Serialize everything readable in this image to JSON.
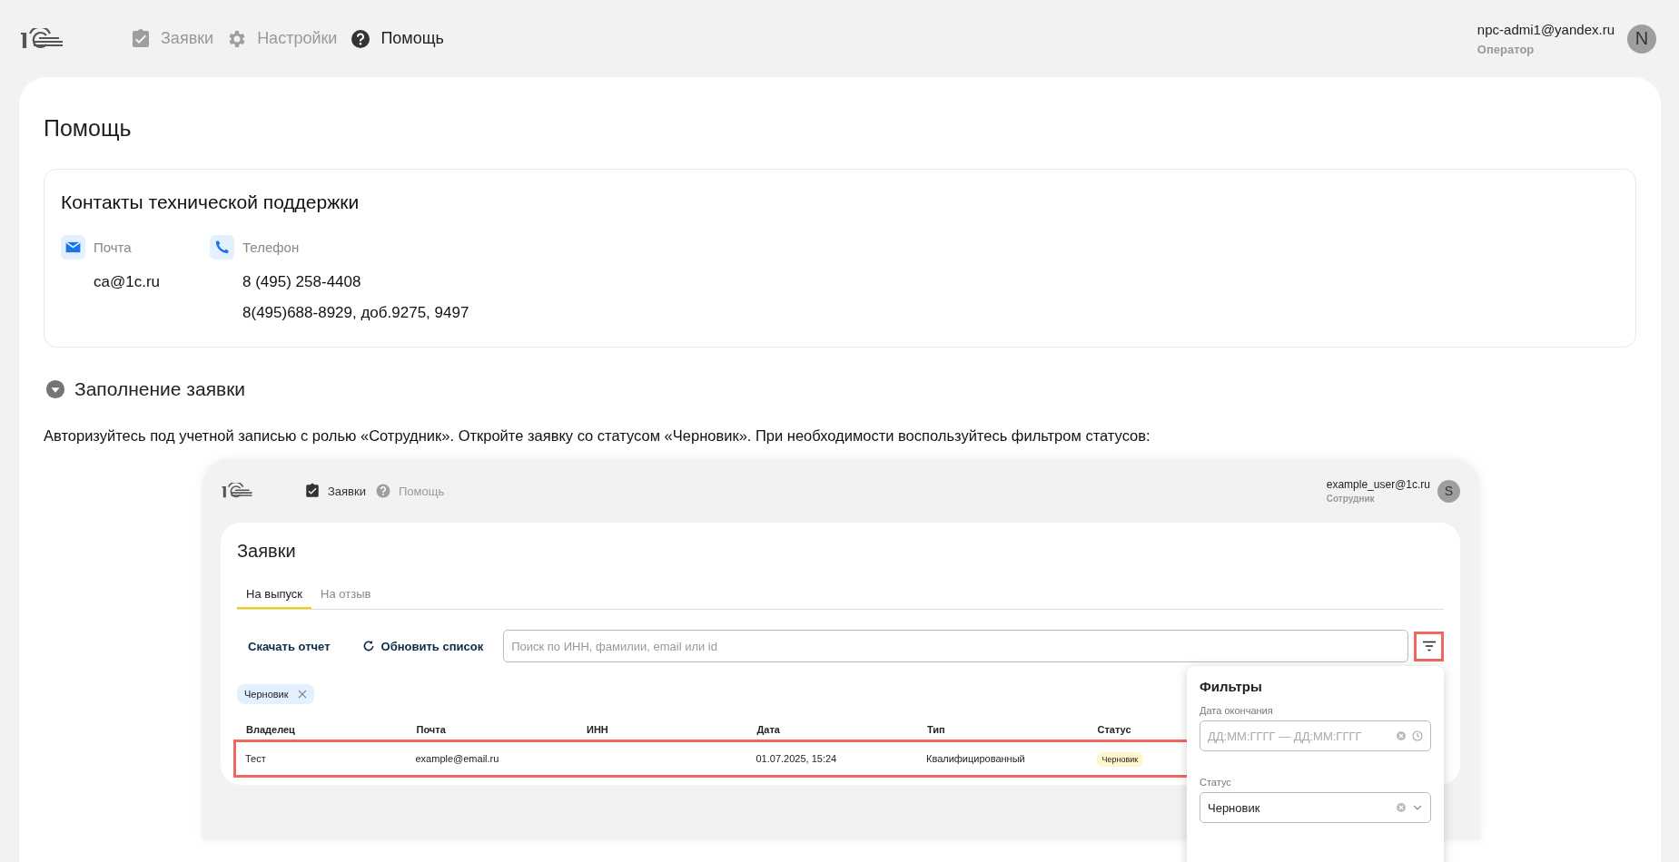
{
  "topbar": {
    "nav": [
      {
        "kind": "clipboard",
        "label": "Заявки",
        "selected": false
      },
      {
        "kind": "gear",
        "label": "Настройки",
        "selected": false
      },
      {
        "kind": "help",
        "label": "Помощь",
        "selected": true
      }
    ],
    "user": {
      "email": "npc-admi1@yandex.ru",
      "role": "Оператор",
      "avatar": "N"
    }
  },
  "page_title": "Помощь",
  "contacts": {
    "title": "Контакты технической поддержки",
    "items": [
      {
        "kind": "email",
        "label": "Почта",
        "values": [
          "ca@1c.ru"
        ]
      },
      {
        "kind": "phone",
        "label": "Телефон",
        "values": [
          "8 (495) 258-4408",
          "8(495)688-8929, доб.9275, 9497"
        ]
      }
    ]
  },
  "section": {
    "title": "Заполнение заявки",
    "expanded": true
  },
  "paragraph": "Авторизуйтесь под учетной записью с ролью «Сотрудник». Откройте заявку со статусом «Черновик». При необходимости воспользуйтесь фильтром статусов:",
  "screenshot": {
    "nav": [
      {
        "kind": "clipboard",
        "label": "Заявки",
        "selected": true
      },
      {
        "kind": "help",
        "label": "Помощь",
        "selected": false
      }
    ],
    "user": {
      "email": "example_user@1c.ru",
      "role": "Сотрудник",
      "avatar": "S"
    },
    "title": "Заявки",
    "tabs": [
      {
        "label": "На выпуск",
        "selected": true
      },
      {
        "label": "На отзыв",
        "selected": false
      }
    ],
    "actions": [
      {
        "kind": "download",
        "label": "Скачать отчет"
      },
      {
        "kind": "refresh",
        "label": "Обновить список"
      }
    ],
    "search": {
      "placeholder": "Поиск по ИНН, фамилии, email или id"
    },
    "filter_button": {
      "highlighted": true
    },
    "chips": [
      {
        "label": "Черновик"
      }
    ],
    "columns": [
      "Владелец",
      "Почта",
      "ИНН",
      "Дата",
      "Тип",
      "Статус"
    ],
    "rows": [
      {
        "cells": [
          "Тест",
          "example@email.ru",
          "",
          "01.07.2025, 15:24",
          "Квалифицированный"
        ],
        "status": "Черновик",
        "highlighted": true
      }
    ],
    "filters": {
      "title": "Фильтры",
      "fields": [
        {
          "kind": "date",
          "label": "Дата окончания",
          "placeholder": "ДД:ММ:ГГГГ — ДД:ММ:ГГГГ"
        },
        {
          "kind": "select",
          "label": "Статус",
          "value": "Черновик"
        }
      ]
    }
  }
}
